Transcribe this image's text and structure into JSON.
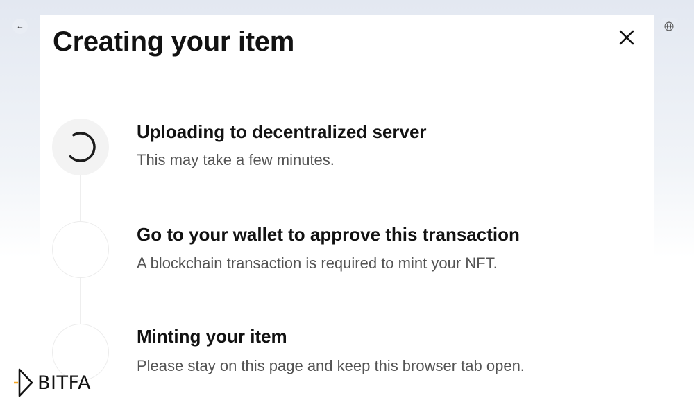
{
  "modal": {
    "title": "Creating your item",
    "close_icon": "close-icon"
  },
  "steps": [
    {
      "title": "Uploading to decentralized server",
      "description": "This may take a few minutes.",
      "status": "in-progress",
      "icon": "spinner-icon"
    },
    {
      "title": "Go to your wallet to approve this transaction",
      "description": "A blockchain transaction is required to mint your NFT.",
      "status": "pending"
    },
    {
      "title": "Minting your item",
      "description": "Please stay on this page and keep this browser tab open.",
      "status": "pending"
    }
  ],
  "background": {
    "back_icon": "arrow-left-icon",
    "globe_icon": "globe-icon"
  },
  "watermark": {
    "text": "BITFA",
    "accent": "#f5a623"
  },
  "colors": {
    "title": "#121212",
    "description": "#545454",
    "circle_border": "#ececec",
    "active_circle": "#f3f3f3"
  }
}
